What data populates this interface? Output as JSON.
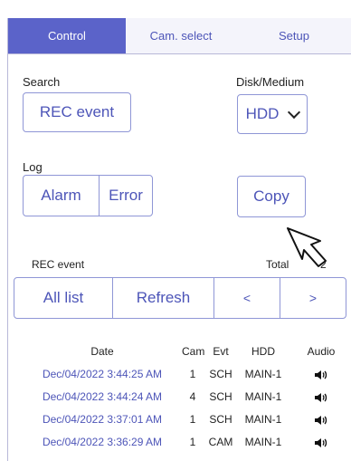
{
  "tabs": [
    {
      "label": "Control",
      "active": true
    },
    {
      "label": "Cam. select",
      "active": false
    },
    {
      "label": "Setup",
      "active": false
    }
  ],
  "search": {
    "label": "Search",
    "rec_event_button": "REC event"
  },
  "disk": {
    "label": "Disk/Medium",
    "selected": "HDD"
  },
  "log": {
    "label": "Log",
    "alarm_button": "Alarm",
    "error_button": "Error",
    "copy_button": "Copy"
  },
  "rec_event": {
    "label": "REC event",
    "total_label": "Total",
    "total_value": "2"
  },
  "list_controls": {
    "all_list": "All list",
    "refresh": "Refresh",
    "prev": "<",
    "next": ">"
  },
  "table": {
    "headers": {
      "date": "Date",
      "cam": "Cam",
      "evt": "Evt",
      "hdd": "HDD",
      "audio": "Audio"
    },
    "rows": [
      {
        "date": "Dec/04/2022 3:44:25 AM",
        "cam": "1",
        "evt": "SCH",
        "hdd": "MAIN-1",
        "audio": "speaker-icon"
      },
      {
        "date": "Dec/04/2022 3:44:24 AM",
        "cam": "4",
        "evt": "SCH",
        "hdd": "MAIN-1",
        "audio": "speaker-icon"
      },
      {
        "date": "Dec/04/2022 3:37:01 AM",
        "cam": "1",
        "evt": "SCH",
        "hdd": "MAIN-1",
        "audio": "speaker-icon"
      },
      {
        "date": "Dec/04/2022 3:36:29 AM",
        "cam": "1",
        "evt": "CAM",
        "hdd": "MAIN-1",
        "audio": "speaker-icon"
      }
    ]
  },
  "colors": {
    "accent": "#5b63c9",
    "link": "#4d55b8",
    "border": "#8f96d6"
  }
}
